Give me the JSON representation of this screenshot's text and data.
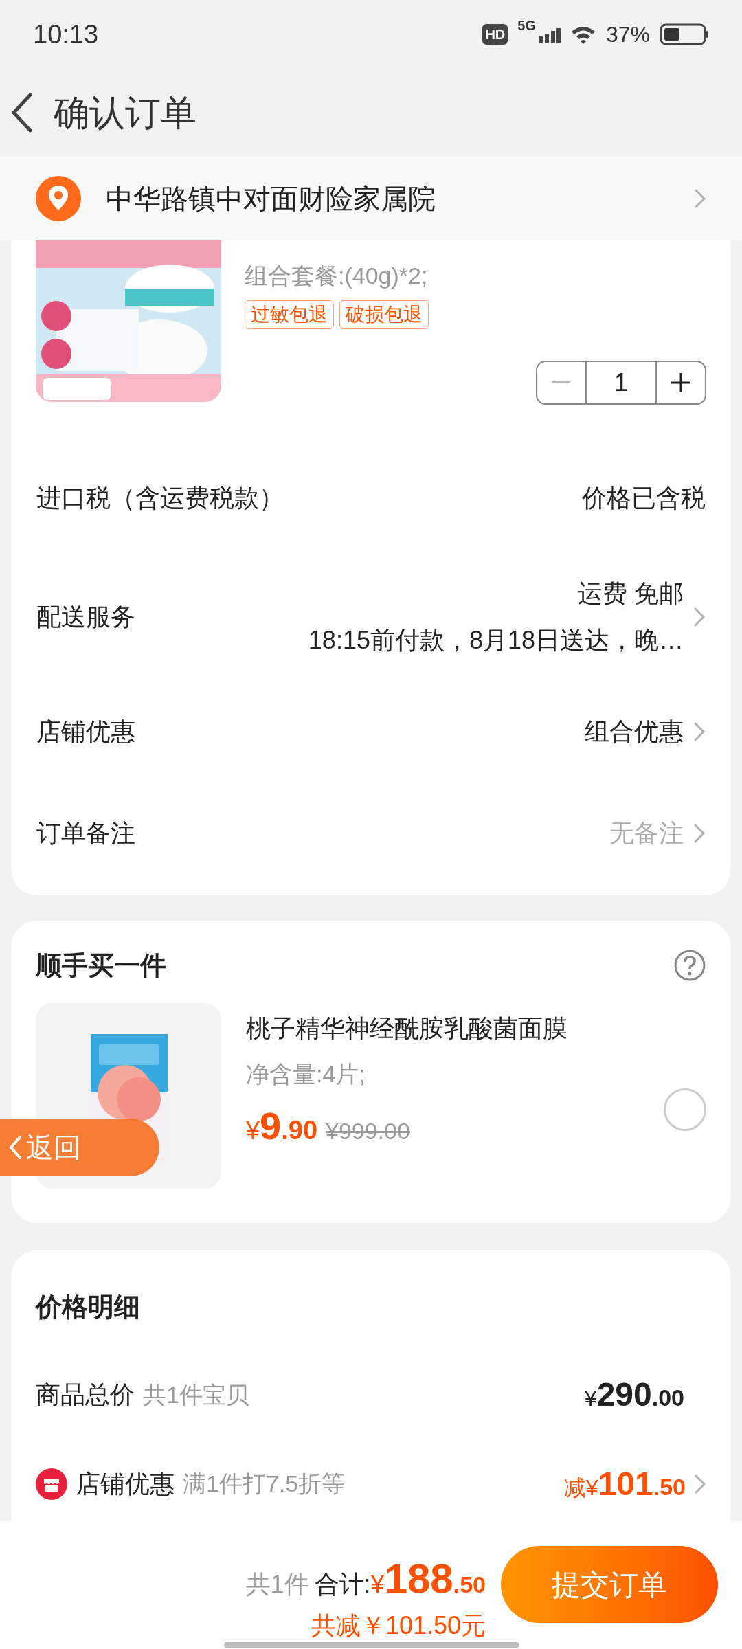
{
  "status_bar": {
    "time": "10:13",
    "hd": "HD",
    "network": "5G",
    "battery": "37%"
  },
  "header": {
    "title": "确认订单"
  },
  "address": {
    "text": "中华路镇中对面财险家属院"
  },
  "product": {
    "spec": "组合套餐:(40g)*2;",
    "tags": [
      "过敏包退",
      "破损包退"
    ],
    "quantity": "1"
  },
  "order_rows": [
    {
      "label": "进口税（含运费税款）",
      "values": [
        "价格已含税"
      ],
      "muted": false,
      "chevron": false
    },
    {
      "label": "配送服务",
      "values": [
        "运费 免邮",
        "18:15前付款，8月18日送达，晚…"
      ],
      "muted": false,
      "chevron": true
    },
    {
      "label": "店铺优惠",
      "values": [
        "组合优惠"
      ],
      "muted": false,
      "chevron": true
    },
    {
      "label": "订单备注",
      "values": [
        "无备注"
      ],
      "muted": true,
      "chevron": true
    }
  ],
  "add_on": {
    "title": "顺手买一件",
    "item": {
      "title": "桃子精华神经酰胺乳酸菌面膜",
      "spec": "净含量:4片;",
      "currency": "¥",
      "integer": "9",
      "decimal": ".90",
      "original_price": "¥999.00",
      "selected": false
    }
  },
  "back_button": {
    "label": "返回"
  },
  "price_detail": {
    "title": "价格明细",
    "rows": [
      {
        "kind": "total",
        "label": "商品总价",
        "note": "共1件宝贝",
        "prefix": "¥",
        "integer": "290",
        "decimal": ".00"
      },
      {
        "kind": "discount",
        "label": "店铺优惠",
        "note": "满1件打7.5折等",
        "prefix": "减¥",
        "integer": "101",
        "decimal": ".50"
      }
    ]
  },
  "footer": {
    "count": "共1件",
    "total_label": "合计:",
    "currency": "¥",
    "integer": "188",
    "decimal": ".50",
    "saving": "共减￥101.50元",
    "submit": "提交订单"
  }
}
